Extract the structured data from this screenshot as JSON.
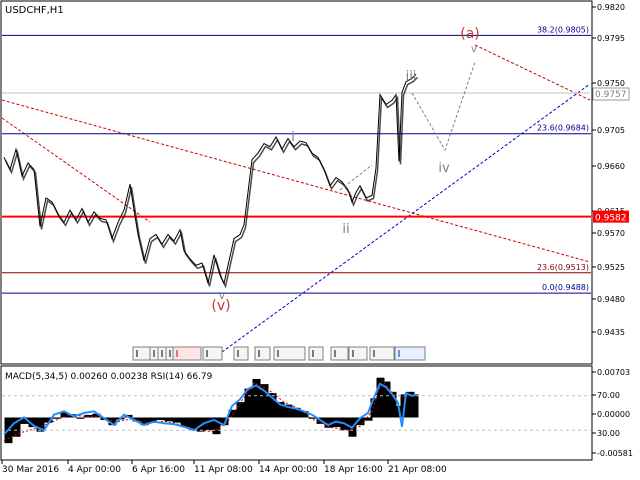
{
  "header": {
    "symbol_label": "USDCHF,H1"
  },
  "indicator": {
    "label": "MACD(5,34,5) 0.00260 0.00238 RSI(14) 66.79"
  },
  "chart_data": {
    "type": "line",
    "title": "USDCHF,H1",
    "price_axis": {
      "range": [
        0.9402,
        0.9846
      ],
      "ticks": [
        "0.9820",
        "0.9795",
        "0.9750",
        "0.9705",
        "0.9660",
        "0.9615",
        "0.9570",
        "0.9525",
        "0.9480",
        "0.9435"
      ]
    },
    "x_axis": {
      "labels": [
        "30 Mar 2016",
        "4 Apr 00:00",
        "6 Apr 16:00",
        "11 Apr 08:00",
        "14 Apr 00:00",
        "18 Apr 16:00",
        "21 Apr 08:00"
      ]
    },
    "levels": [
      {
        "name": "38.2",
        "label": "38.2(0.9805)",
        "value": 0.9805,
        "color": "#00008b"
      },
      {
        "name": "23.6",
        "label": "23.6(0.9684)",
        "value": 0.9684,
        "color": "#00008b"
      },
      {
        "name": "support",
        "label": "0.9582",
        "value": 0.9582,
        "color": "#ff0000"
      },
      {
        "name": "23.6-red",
        "label": "23.6(0.9513)",
        "value": 0.9513,
        "color": "#8b0000"
      },
      {
        "name": "0.0",
        "label": "0.0(0.9488)",
        "value": 0.9488,
        "color": "#00008b"
      }
    ],
    "current_price": {
      "label": "0.9757",
      "value": 0.9757
    },
    "wave_labels": [
      {
        "text": "(a)",
        "color": "#c0392b"
      },
      {
        "text": "iii",
        "color": "#808080"
      },
      {
        "text": "i",
        "color": "#808080"
      },
      {
        "text": "iv",
        "color": "#808080"
      },
      {
        "text": "ii",
        "color": "#808080"
      },
      {
        "text": "(v)",
        "color": "#c0392b"
      }
    ],
    "price_series": [
      [
        0,
        0.9655
      ],
      [
        6,
        0.964
      ],
      [
        12,
        0.9665
      ],
      [
        18,
        0.9632
      ],
      [
        24,
        0.9648
      ],
      [
        30,
        0.964
      ],
      [
        36,
        0.957
      ],
      [
        42,
        0.9605
      ],
      [
        48,
        0.96
      ],
      [
        54,
        0.9585
      ],
      [
        60,
        0.9575
      ],
      [
        66,
        0.959
      ],
      [
        72,
        0.9578
      ],
      [
        78,
        0.9592
      ],
      [
        84,
        0.9575
      ],
      [
        90,
        0.9588
      ],
      [
        96,
        0.958
      ],
      [
        102,
        0.9578
      ],
      [
        108,
        0.9555
      ],
      [
        114,
        0.9575
      ],
      [
        120,
        0.959
      ],
      [
        126,
        0.9622
      ],
      [
        130,
        0.959
      ],
      [
        134,
        0.956
      ],
      [
        140,
        0.9528
      ],
      [
        146,
        0.9555
      ],
      [
        152,
        0.956
      ],
      [
        158,
        0.9548
      ],
      [
        164,
        0.956
      ],
      [
        170,
        0.9552
      ],
      [
        176,
        0.9566
      ],
      [
        180,
        0.954
      ],
      [
        186,
        0.953
      ],
      [
        192,
        0.9522
      ],
      [
        198,
        0.9525
      ],
      [
        204,
        0.95
      ],
      [
        210,
        0.9535
      ],
      [
        216,
        0.951
      ],
      [
        220,
        0.95
      ],
      [
        224,
        0.9522
      ],
      [
        230,
        0.9555
      ],
      [
        236,
        0.956
      ],
      [
        240,
        0.9572
      ],
      [
        244,
        0.9612
      ],
      [
        248,
        0.9652
      ],
      [
        254,
        0.966
      ],
      [
        260,
        0.9672
      ],
      [
        266,
        0.9668
      ],
      [
        272,
        0.968
      ],
      [
        278,
        0.9665
      ],
      [
        284,
        0.9678
      ],
      [
        290,
        0.9668
      ],
      [
        296,
        0.9675
      ],
      [
        302,
        0.9673
      ],
      [
        308,
        0.966
      ],
      [
        314,
        0.9655
      ],
      [
        320,
        0.964
      ],
      [
        326,
        0.962
      ],
      [
        332,
        0.963
      ],
      [
        338,
        0.9625
      ],
      [
        344,
        0.9615
      ],
      [
        348,
        0.96
      ],
      [
        352,
        0.9612
      ],
      [
        356,
        0.962
      ],
      [
        362,
        0.9605
      ],
      [
        368,
        0.9608
      ],
      [
        372,
        0.9642
      ],
      [
        376,
        0.9732
      ],
      [
        382,
        0.972
      ],
      [
        388,
        0.9725
      ],
      [
        392,
        0.9732
      ],
      [
        395,
        0.965
      ],
      [
        398,
        0.9735
      ],
      [
        402,
        0.9748
      ],
      [
        408,
        0.9752
      ],
      [
        412,
        0.9757
      ]
    ],
    "macd": {
      "range": [
        -0.006,
        0.0074
      ],
      "ticks": [
        "0.00703",
        "0.00000",
        "-0.00581"
      ],
      "histogram": [
        [
          4,
          -0.004
        ],
        [
          12,
          -0.003
        ],
        [
          20,
          -0.001
        ],
        [
          28,
          -0.0015
        ],
        [
          36,
          -0.0022
        ],
        [
          44,
          -0.0008
        ],
        [
          52,
          -0.0002
        ],
        [
          60,
          0.0008
        ],
        [
          68,
          0.0005
        ],
        [
          76,
          -0.0002
        ],
        [
          84,
          0.0004
        ],
        [
          92,
          0.0006
        ],
        [
          100,
          -0.0004
        ],
        [
          108,
          -0.0012
        ],
        [
          116,
          -0.0003
        ],
        [
          124,
          0.0004
        ],
        [
          132,
          -0.0006
        ],
        [
          140,
          -0.0012
        ],
        [
          148,
          -0.0008
        ],
        [
          156,
          -0.0004
        ],
        [
          164,
          -0.0006
        ],
        [
          172,
          -0.0008
        ],
        [
          180,
          -0.0015
        ],
        [
          188,
          -0.002
        ],
        [
          196,
          -0.0022
        ],
        [
          204,
          -0.002
        ],
        [
          212,
          -0.0026
        ],
        [
          220,
          -0.0012
        ],
        [
          228,
          0.0012
        ],
        [
          236,
          0.0024
        ],
        [
          244,
          0.0045
        ],
        [
          252,
          0.006
        ],
        [
          260,
          0.0052
        ],
        [
          268,
          0.0038
        ],
        [
          276,
          0.0024
        ],
        [
          284,
          0.002
        ],
        [
          292,
          0.0015
        ],
        [
          300,
          0.001
        ],
        [
          308,
          -0.0002
        ],
        [
          316,
          -0.001
        ],
        [
          324,
          -0.0016
        ],
        [
          332,
          -0.0015
        ],
        [
          340,
          -0.002
        ],
        [
          348,
          -0.003
        ],
        [
          356,
          -0.0012
        ],
        [
          364,
          -0.0005
        ],
        [
          370,
          0.003
        ],
        [
          376,
          0.0062
        ],
        [
          382,
          0.0056
        ],
        [
          388,
          0.004
        ],
        [
          394,
          0.0018
        ],
        [
          400,
          0.0036
        ],
        [
          406,
          0.004
        ],
        [
          410,
          0.0036
        ]
      ],
      "signal": [
        [
          0,
          -0.0036
        ],
        [
          16,
          -0.0024
        ],
        [
          32,
          -0.0017
        ],
        [
          48,
          -0.0007
        ],
        [
          64,
          0.0004
        ],
        [
          80,
          0.0002
        ],
        [
          96,
          0.0001
        ],
        [
          112,
          -0.0007
        ],
        [
          128,
          -0.0002
        ],
        [
          144,
          -0.0009
        ],
        [
          160,
          -0.0006
        ],
        [
          176,
          -0.0011
        ],
        [
          192,
          -0.0019
        ],
        [
          208,
          -0.0022
        ],
        [
          222,
          -0.001
        ],
        [
          236,
          0.0022
        ],
        [
          250,
          0.0054
        ],
        [
          264,
          0.0044
        ],
        [
          280,
          0.0024
        ],
        [
          296,
          0.0013
        ],
        [
          310,
          -0.0004
        ],
        [
          326,
          -0.0015
        ],
        [
          342,
          -0.002
        ],
        [
          356,
          -0.0014
        ],
        [
          368,
          0.001
        ],
        [
          378,
          0.0058
        ],
        [
          390,
          0.0036
        ],
        [
          400,
          0.0032
        ],
        [
          410,
          0.0037
        ]
      ]
    },
    "rsi": {
      "ticks": [
        "70.00",
        "30.00"
      ],
      "levels": [
        70,
        30
      ],
      "series": [
        [
          0,
          25
        ],
        [
          10,
          38
        ],
        [
          20,
          45
        ],
        [
          30,
          35
        ],
        [
          40,
          30
        ],
        [
          50,
          48
        ],
        [
          60,
          52
        ],
        [
          70,
          46
        ],
        [
          80,
          50
        ],
        [
          90,
          52
        ],
        [
          100,
          44
        ],
        [
          110,
          36
        ],
        [
          120,
          48
        ],
        [
          130,
          42
        ],
        [
          140,
          36
        ],
        [
          150,
          40
        ],
        [
          160,
          38
        ],
        [
          170,
          37
        ],
        [
          180,
          34
        ],
        [
          190,
          30
        ],
        [
          200,
          38
        ],
        [
          210,
          42
        ],
        [
          220,
          36
        ],
        [
          228,
          58
        ],
        [
          236,
          66
        ],
        [
          244,
          78
        ],
        [
          252,
          82
        ],
        [
          260,
          76
        ],
        [
          268,
          68
        ],
        [
          276,
          60
        ],
        [
          284,
          57
        ],
        [
          292,
          55
        ],
        [
          300,
          52
        ],
        [
          308,
          48
        ],
        [
          316,
          42
        ],
        [
          324,
          36
        ],
        [
          332,
          40
        ],
        [
          340,
          38
        ],
        [
          348,
          33
        ],
        [
          356,
          44
        ],
        [
          364,
          50
        ],
        [
          370,
          68
        ],
        [
          376,
          84
        ],
        [
          382,
          80
        ],
        [
          388,
          72
        ],
        [
          394,
          62
        ],
        [
          398,
          34
        ],
        [
          402,
          73
        ],
        [
          408,
          70
        ],
        [
          412,
          71
        ]
      ]
    }
  }
}
